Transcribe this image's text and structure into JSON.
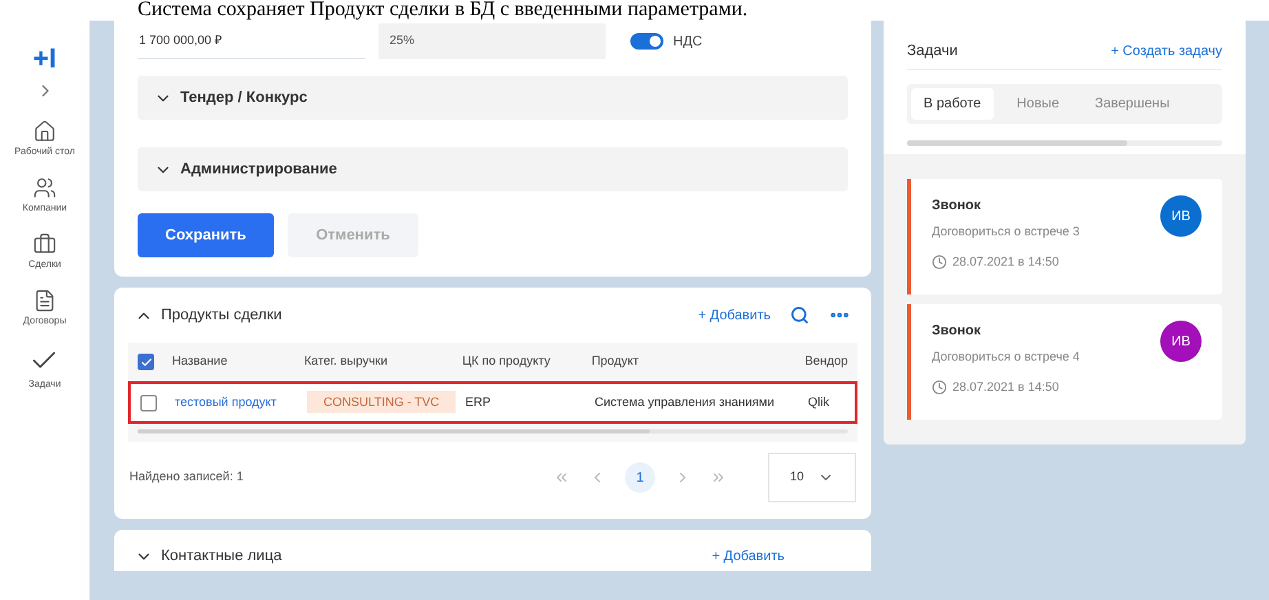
{
  "caption": "Система сохраняет Продукт сделки в БД с введенными параметрами.",
  "sidebar": {
    "logo": "+I",
    "items": [
      {
        "kind": "home",
        "label": "Рабочий стол"
      },
      {
        "kind": "users",
        "label": "Компании"
      },
      {
        "kind": "briefcase",
        "label": "Сделки"
      },
      {
        "kind": "document",
        "label": "Договоры"
      },
      {
        "kind": "check",
        "label": "Задачи"
      }
    ]
  },
  "deal_form": {
    "amount": "1 700 000,00 ₽",
    "percent": "25%",
    "vat": {
      "label": "НДС",
      "on": true
    },
    "sections": [
      {
        "title": "Тендер / Конкурс",
        "expanded": false
      },
      {
        "title": "Администрирование",
        "expanded": false
      }
    ],
    "buttons": [
      {
        "label": "Сохранить",
        "disabled": false
      },
      {
        "label": "Отменить",
        "disabled": true
      }
    ]
  },
  "products": {
    "title": "Продукты сделки",
    "expanded": true,
    "add": "+ Добавить",
    "columns": [
      "Название",
      "Катег. выручки",
      "ЦК по продукту",
      "Продукт",
      "Вендор"
    ],
    "all_checked": true,
    "rows": [
      {
        "checked": false,
        "highlighted": true,
        "name": "тестовый продукт",
        "category": "CONSULTING - TVC",
        "cc": "ERP",
        "product": "Система управления знаниями",
        "vendor": "Qlik"
      }
    ],
    "found": "Найдено записей: 1",
    "pages": [
      {
        "label": "1",
        "selected": true
      }
    ],
    "page_size": "10"
  },
  "contacts": {
    "title": "Контактные лица",
    "expanded": false,
    "add": "+ Добавить"
  },
  "tasks": {
    "title": "Задачи",
    "create": "+ Создать задачу",
    "tabs": [
      {
        "label": "В работе",
        "selected": true
      },
      {
        "label": "Новые",
        "selected": false
      },
      {
        "label": "Завершены",
        "selected": false
      }
    ],
    "items": [
      {
        "title": "Звонок",
        "text": "Договориться о встрече 3",
        "time": "28.07.2021 в 14:50",
        "initials": "ИВ",
        "color": "#0b6fd0"
      },
      {
        "title": "Звонок",
        "text": "Договориться о встрече 4",
        "time": "28.07.2021 в 14:50",
        "initials": "ИВ",
        "color": "#a30fb8"
      }
    ]
  }
}
